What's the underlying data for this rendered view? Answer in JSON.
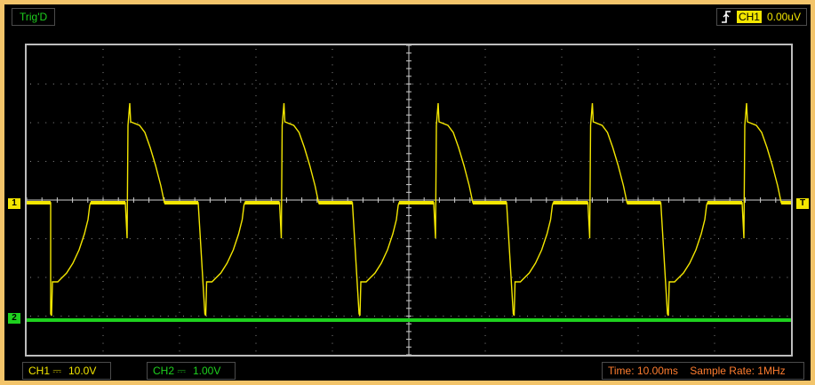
{
  "top": {
    "trigger_state": "Trig'D",
    "trigger_channel": "CH1",
    "trigger_level": "0.00uV",
    "trigger_edge_icon": "rising-edge-icon"
  },
  "markers": {
    "ch1": "1",
    "ch2": "2",
    "trigger": "T"
  },
  "bottom": {
    "ch1_label": "CH1",
    "ch1_scale": "10.0V",
    "ch2_label": "CH2",
    "ch2_scale": "1.00V",
    "time_label": "Time: 10.00ms",
    "sample_label": "Sample Rate: 1MHz"
  },
  "colors": {
    "ch1": "#f3e600",
    "ch2": "#1ed11e",
    "frame": "#f3c46a",
    "grid_dots": "#8a8a8a",
    "time_text": "#ff7d2f"
  }
}
